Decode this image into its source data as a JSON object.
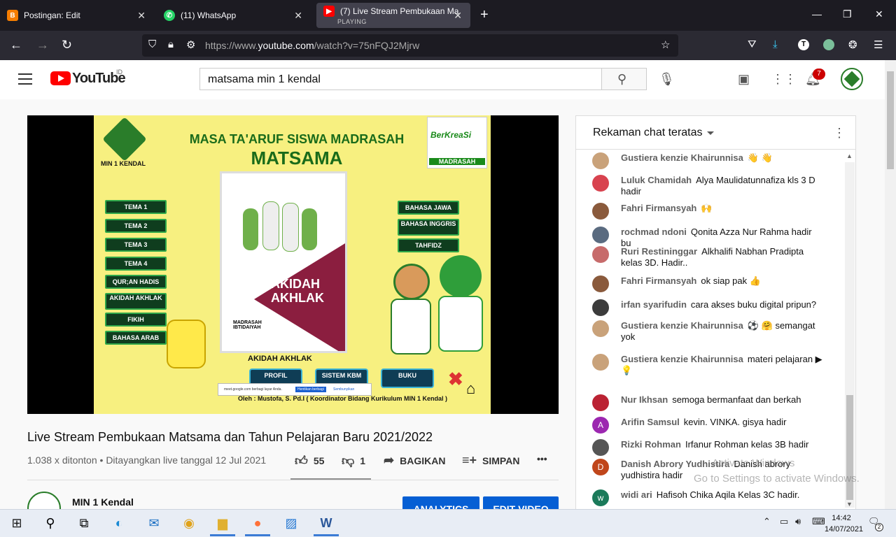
{
  "browser": {
    "tabs": [
      {
        "title": "Postingan: Edit",
        "icon": "blogger-icon",
        "color": "#f57d00"
      },
      {
        "title": "(11) WhatsApp",
        "icon": "whatsapp-icon",
        "color": "#25d366"
      },
      {
        "title": "(7) Live Stream Pembukaan Ma",
        "sub": "PLAYING",
        "icon": "youtube-icon",
        "color": "#ff0000"
      }
    ],
    "new_tab": "+",
    "url_prefix": "https://www.",
    "url_host": "youtube.com",
    "url_path": "/watch?v=75nFQJ2Mjrw"
  },
  "youtube": {
    "logo_text": "YouTube",
    "region": "ID",
    "search_value": "matsama min 1 kendal",
    "notifications": "7"
  },
  "slide": {
    "title": "MASA TA'ARUF SISWA MADRASAH",
    "subtitle": "MATSAMA",
    "logo_label": "MIN 1 KENDAL",
    "berkreasi": "BerKreaSi",
    "berkreasi_sub": "MADRASAH",
    "left_buttons": [
      "TEMA 1",
      "TEMA 2",
      "TEMA 3",
      "TEMA 4",
      "QUR;AN HADIS",
      "AKIDAH AKHLAK",
      "FIKIH",
      "BAHASA ARAB"
    ],
    "right_buttons": [
      "BAHASA JAWA",
      "BAHASA INGGRIS",
      "TAHFIDZ"
    ],
    "book_title": "AKIDAH AKHLAK",
    "book_badge": "MADRASAH IBTIDAIYAH",
    "caption": "AKIDAH AKHLAK",
    "bottom_buttons": [
      "PROFIL",
      "SISTEM KBM",
      "BUKU"
    ],
    "footer": "Oleh : Mustofa, S. Pd.I ( Koordinator Bidang Kurikulum MIN 1 Kendal )",
    "meet_text": "meet.google.com berbagi layar Anda.",
    "meet_stop": "Hentikan berbagi",
    "meet_hide": "Sembunyikan"
  },
  "video": {
    "title": "Live Stream Pembukaan Matsama dan Tahun Pelajaran Baru 2021/2022",
    "views": "1.038 x ditonton • Ditayangkan live tanggal 12 Jul 2021",
    "likes": "55",
    "dislikes": "1",
    "share": "BAGIKAN",
    "save": "SIMPAN",
    "more": "•••",
    "channel": "MIN 1 Kendal",
    "analytics": "ANALYTICS",
    "edit": "EDIT VIDEO"
  },
  "chat": {
    "header": "Rekaman chat teratas",
    "messages": [
      {
        "name": "Gustiera kenzie Khairunnisa",
        "text": "👋 👋",
        "avatar_color": "#c9a27a",
        "initial": ""
      },
      {
        "name": "Luluk Chamidah",
        "text": "Alya Maulidatunnafiza kls 3 D hadir",
        "avatar_color": "#d8434f",
        "initial": ""
      },
      {
        "name": "Fahri Firmansyah",
        "text": "🙌",
        "avatar_color": "#8a5a3c",
        "initial": ""
      },
      {
        "name": "rochmad ndoni",
        "text": "Qonita Azza Nur Rahma hadir bu",
        "avatar_color": "#5a6b80",
        "initial": ""
      },
      {
        "name": "Ruri Restininggar",
        "text": "Alkhalifi Nabhan Pradipta kelas 3D. Hadir..",
        "avatar_color": "#c76b6b",
        "initial": ""
      },
      {
        "name": "Fahri Firmansyah",
        "text": "ok siap pak 👍",
        "avatar_color": "#8a5a3c",
        "initial": ""
      },
      {
        "name": "irfan syarifudin",
        "text": "cara akses buku digital pripun?",
        "avatar_color": "#3c3c3c",
        "initial": ""
      },
      {
        "name": "Gustiera kenzie Khairunnisa",
        "text": "⚽ 🤗 semangat yok",
        "avatar_color": "#c9a27a",
        "initial": ""
      },
      {
        "name": "Gustiera kenzie Khairunnisa",
        "text": "materi pelajaran ▶ 💡",
        "avatar_color": "#c9a27a",
        "initial": ""
      },
      {
        "name": "Nur Ikhsan",
        "text": "semoga bermanfaat dan berkah",
        "avatar_color": "#b23",
        "initial": ""
      },
      {
        "name": "Arifin Samsul",
        "text": "kevin. VINKA. gisya hadir",
        "avatar_color": "#9c27b0",
        "initial": "A"
      },
      {
        "name": "Rizki Rohman",
        "text": "Irfanur Rohman kelas 3B hadir",
        "avatar_color": "#555",
        "initial": ""
      },
      {
        "name": "Danish Abrory Yudhistira",
        "text": "Danish abrory yudhistira hadir",
        "avatar_color": "#c0461b",
        "initial": "D"
      },
      {
        "name": "widi ari",
        "text": "Hafisoh Chika Aqila Kelas 3C hadir.",
        "avatar_color": "#1b7a5a",
        "initial": "w"
      }
    ]
  },
  "watermark": {
    "line1": "Activate Windows",
    "line2": "Go to Settings to activate Windows."
  },
  "taskbar": {
    "time": "14:42",
    "date": "14/07/2021",
    "notif_count": "2"
  }
}
